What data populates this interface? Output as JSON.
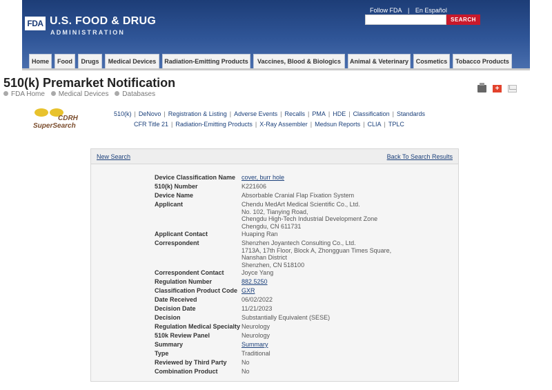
{
  "header": {
    "logo_mark": "FDA",
    "title": "U.S. FOOD & DRUG",
    "subtitle": "ADMINISTRATION",
    "follow": "Follow FDA",
    "divider": "|",
    "espanol": "En Español",
    "search_placeholder": "",
    "search_button": "SEARCH"
  },
  "nav": [
    "Home",
    "Food",
    "Drugs",
    "Medical Devices",
    "Radiation-Emitting Products",
    "Vaccines, Blood & Biologics",
    "Animal & Veterinary",
    "Cosmetics",
    "Tobacco Products"
  ],
  "page": {
    "title": "510(k) Premarket Notification",
    "breadcrumb": [
      "FDA Home",
      "Medical Devices",
      "Databases"
    ]
  },
  "cdrh": {
    "top": "CDRH",
    "bottom": "SuperSearch"
  },
  "db_links_row1": [
    "510(k)",
    "DeNovo",
    "Registration & Listing",
    "Adverse Events",
    "Recalls",
    "PMA",
    "HDE",
    "Classification",
    "Standards"
  ],
  "db_links_row2": [
    "CFR Title 21",
    "Radiation-Emitting Products",
    "X-Ray Assembler",
    "Medsun Reports",
    "CLIA",
    "TPLC"
  ],
  "results": {
    "new_search": "New Search",
    "back": "Back To Search Results"
  },
  "record": {
    "device_classification_name": {
      "label": "Device Classification Name",
      "value": "cover, burr hole"
    },
    "k_number": {
      "label": "510(k) Number",
      "value": "K221606"
    },
    "device_name": {
      "label": "Device Name",
      "value": "Absorbable Cranial Flap Fixation System"
    },
    "applicant": {
      "label": "Applicant",
      "lines": [
        "Chendu MedArt Medical Scientific Co., Ltd.",
        "No. 102, Tianying Road,",
        "Chengdu High-Tech Industrial Development Zone",
        "Chengdu,  CN 611731"
      ]
    },
    "applicant_contact": {
      "label": "Applicant Contact",
      "value": "Huaping Ran"
    },
    "correspondent": {
      "label": "Correspondent",
      "lines": [
        "Shenzhen Joyantech Consulting Co., Ltd.",
        "1713A, 17th Floor, Block A, Zhongguan Times Square,",
        "Nanshan District",
        "Shenzhen,  CN 518100"
      ]
    },
    "correspondent_contact": {
      "label": "Correspondent Contact",
      "value": "Joyce Yang"
    },
    "regulation_number": {
      "label": "Regulation Number",
      "value": "882.5250"
    },
    "classification_product_code": {
      "label": "Classification Product Code",
      "value": "GXR"
    },
    "date_received": {
      "label": "Date Received",
      "value": "06/02/2022"
    },
    "decision_date": {
      "label": "Decision Date",
      "value": "11/21/2023"
    },
    "decision": {
      "label": "Decision",
      "value": "Substantially Equivalent (SESE)"
    },
    "regulation_medical_specialty": {
      "label": "Regulation Medical Specialty",
      "value": "Neurology"
    },
    "review_panel": {
      "label": "510k Review Panel",
      "value": "Neurology"
    },
    "summary": {
      "label": "Summary",
      "value": "Summary"
    },
    "type": {
      "label": "Type",
      "value": "Traditional"
    },
    "third_party": {
      "label": "Reviewed by Third Party",
      "value": "No"
    },
    "combination_product": {
      "label": "Combination Product",
      "value": "No"
    }
  }
}
